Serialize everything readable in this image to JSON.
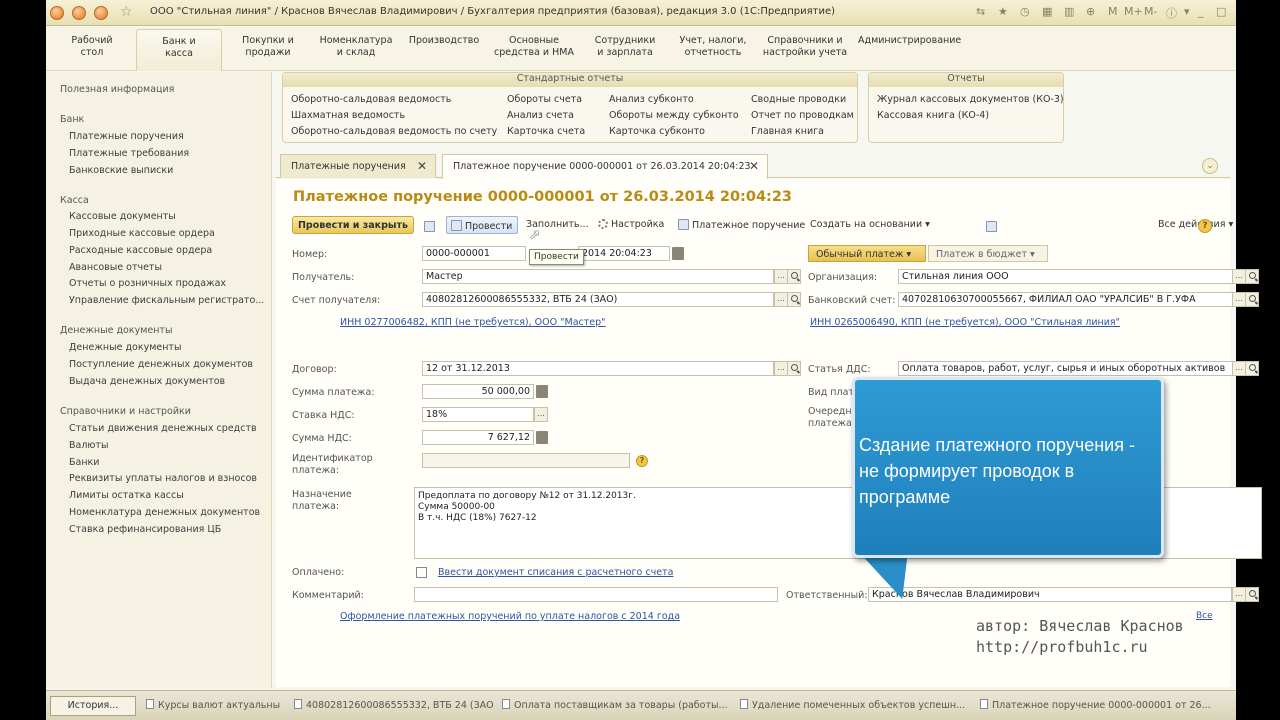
{
  "window": {
    "title": "ООО \"Стильная линия\" / Краснов Вячеслав Владимирович / Бухгалтерия предприятия (базовая), редакция 3.0  (1С:Предприятие)"
  },
  "sections": [
    {
      "label": "Рабочий\nстол"
    },
    {
      "label": "Банк и\nкасса"
    },
    {
      "label": "Покупки и\nпродажи"
    },
    {
      "label": "Номенклатура\nи склад"
    },
    {
      "label": "Производство"
    },
    {
      "label": "Основные\nсредства и НМА"
    },
    {
      "label": "Сотрудники\nи зарплата"
    },
    {
      "label": "Учет, налоги,\nотчетность"
    },
    {
      "label": "Справочники и\nнастройки учета"
    },
    {
      "label": "Администрирование"
    }
  ],
  "nav": {
    "useful_info": "Полезная информация",
    "groups": [
      {
        "title": "Банк",
        "items": [
          "Платежные поручения",
          "Платежные требования",
          "Банковские выписки"
        ]
      },
      {
        "title": "Касса",
        "items": [
          "Кассовые документы",
          "Приходные кассовые ордера",
          "Расходные кассовые ордера",
          "Авансовые отчеты",
          "Отчеты о розничных продажах",
          "Управление фискальным регистрато..."
        ]
      },
      {
        "title": "Денежные документы",
        "items": [
          "Денежные документы",
          "Поступление денежных документов",
          "Выдача денежных документов"
        ]
      },
      {
        "title": "Справочники и настройки",
        "items": [
          "Статьи движения денежных средств",
          "Валюты",
          "Банки",
          "Реквизиты уплаты налогов и взносов",
          "Лимиты остатка кассы",
          "Номенклатура денежных документов",
          "Ставка рефинансирования ЦБ"
        ]
      }
    ]
  },
  "reports": {
    "standard_title": "Стандартные отчеты",
    "col1": [
      "Оборотно-сальдовая ведомость",
      "Шахматная ведомость",
      "Оборотно-сальдовая ведомость по счету"
    ],
    "col2": [
      "Обороты счета",
      "Анализ счета",
      "Карточка счета"
    ],
    "col3": [
      "Анализ субконто",
      "Обороты между субконто",
      "Карточка субконто"
    ],
    "col4": [
      "Сводные проводки",
      "Отчет по проводкам",
      "Главная книга"
    ],
    "reports_title": "Отчеты",
    "col5": [
      "Журнал кассовых документов (КО-3)",
      "Кассовая книга (КО-4)"
    ]
  },
  "tabs": {
    "tab1": "Платежные поручения",
    "tab2": "Платежное поручение 0000-000001 от 26.03.2014 20:04:23",
    "close": "✕",
    "collapse": "⌄"
  },
  "form": {
    "title": "Платежное поручение 0000-000001 от 26.03.2014 20:04:23",
    "toolbar": {
      "post_close": "Провести и закрыть",
      "post": "Провести",
      "fill": "Заполнить...",
      "settings": "Настройка",
      "print": "Платежное поручение",
      "create_based": "Создать на основании",
      "all_actions": "Все действия",
      "tooltip": "Провести",
      "help": "?"
    },
    "number_label": "Номер:",
    "number": "0000-000001",
    "date": "2014 20:04:23",
    "payment_type": "Обычный платеж",
    "budget_payment": "Платеж в бюджет",
    "recipient_label": "Получатель:",
    "recipient": "Мастер",
    "org_label": "Организация:",
    "org": "Стильная линия ООО",
    "recipient_account_label": "Счет получателя:",
    "recipient_account": "40802812600086555332, ВТБ 24 (ЗАО)",
    "bank_account_label": "Банковский счет:",
    "bank_account": "40702810630700055667, ФИЛИАЛ ОАО \"УРАЛСИБ\" В Г.УФА",
    "inn_recipient": "ИНН 0277006482, КПП (не требуется), ООО \"Мастер\"",
    "inn_org": "ИНН 0265006490, КПП (не требуется), ООО \"Стильная линия\"",
    "contract_label": "Договор:",
    "contract": "12 от 31.12.2013",
    "dds_label": "Статья ДДС:",
    "dds": "Оплата товаров, работ, услуг, сырья и иных оборотных активов",
    "sum_label": "Сумма платежа:",
    "sum": "50 000,00",
    "vid_label": "Вид платежа:",
    "vat_rate_label": "Ставка НДС:",
    "vat_rate": "18%",
    "order_label": "Очередность\nплатежа:",
    "vat_sum_label": "Сумма НДС:",
    "vat_sum": "7 627,12",
    "ident_label": "Идентификатор\nплатежа:",
    "ident_help": "?",
    "purpose_label": "Назначение\nплатежа:",
    "purpose": "Предоплата по договору №12 от 31.12.2013г.\nСумма 50000-00\nВ т.ч. НДС  (18%) 7627-12",
    "paid_label": "Оплачено:",
    "paid_link": "Ввести документ списания с расчетного счета",
    "comment_label": "Комментарий:",
    "responsible_label": "Ответственный:",
    "responsible": "Краснов Вячеслав Владимирович",
    "taxes_link": "Оформление платежных поручений по уплате налогов с 2014 года",
    "all_link": "Все"
  },
  "callout": {
    "text": "Сздание платежного поручения - не формирует проводок в программе"
  },
  "author": {
    "line1": "автор: Вячеслав Краснов",
    "line2": "http://profbuh1c.ru"
  },
  "taskbar": {
    "history": "История...",
    "items": [
      "Курсы валют актуальны",
      "40802812600086555332, ВТБ 24 (ЗАО)",
      "Оплата поставщикам за товары (работы...",
      "Удаление помеченных объектов успешн...",
      "Платежное поручение 0000-000001 от 26..."
    ]
  },
  "colors": {
    "title_gold": "#b98a14",
    "callout_blue": "#2a8fc9",
    "link_blue": "#2f55a4"
  }
}
